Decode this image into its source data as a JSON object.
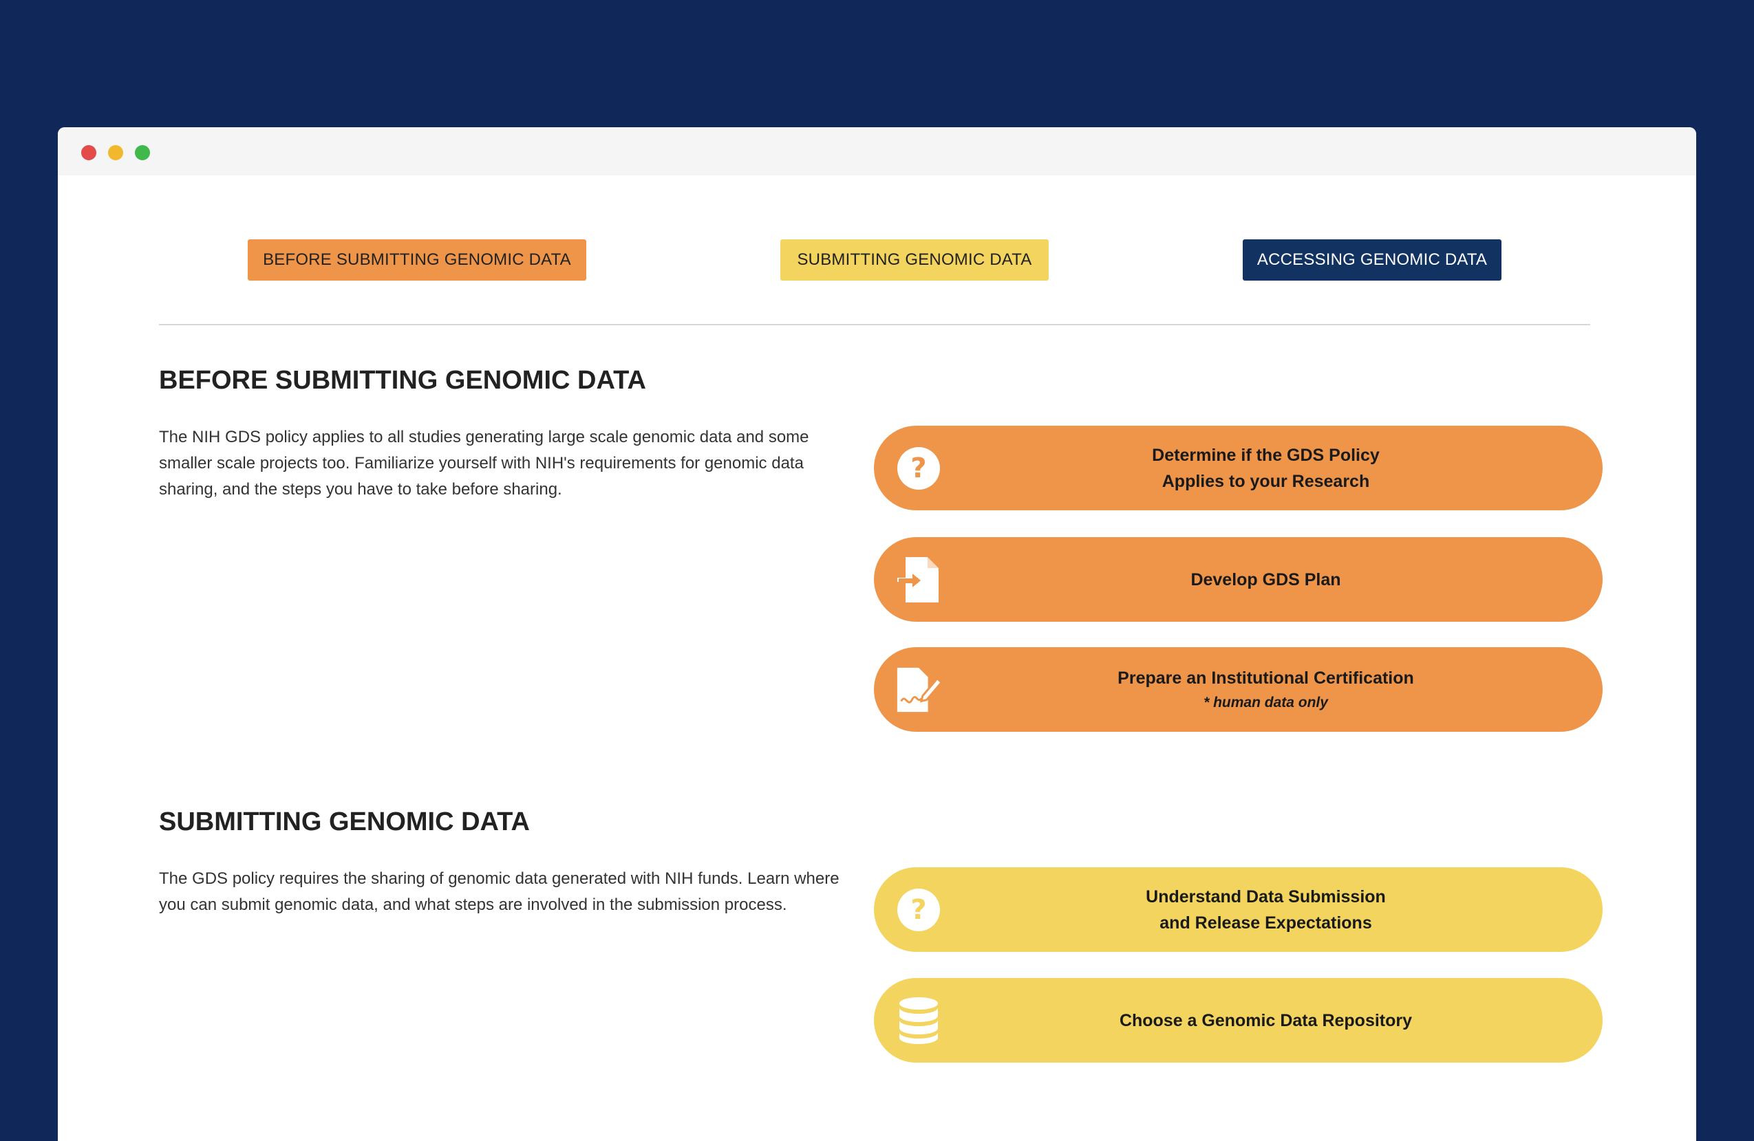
{
  "tabs": [
    {
      "label": "BEFORE SUBMITTING GENOMIC DATA",
      "color": "#ee954a"
    },
    {
      "label": "SUBMITTING GENOMIC DATA",
      "color": "#f2d45f"
    },
    {
      "label": "ACCESSING GENOMIC DATA",
      "color": "#123361"
    }
  ],
  "sections": [
    {
      "heading": "BEFORE SUBMITTING GENOMIC DATA",
      "description": "The NIH GDS policy applies to all studies generating large scale genomic data and some smaller scale projects too. Familiarize yourself with NIH's requirements for genomic data sharing, and the steps you have to take before sharing.",
      "buttons": [
        {
          "line1": "Determine if the GDS Policy",
          "line2": "Applies to your Research",
          "icon": "question-circle-icon"
        },
        {
          "line1": "Develop GDS Plan",
          "icon": "document-import-icon"
        },
        {
          "line1": "Prepare an Institutional Certification",
          "note": "* human data only",
          "icon": "document-signature-icon"
        }
      ]
    },
    {
      "heading": "SUBMITTING GENOMIC DATA",
      "description": "The GDS policy requires the sharing of genomic data generated with NIH funds. Learn where you can submit genomic data, and what steps are involved in the submission process.",
      "buttons": [
        {
          "line1": "Understand Data Submission",
          "line2": "and Release Expectations",
          "icon": "question-circle-icon"
        },
        {
          "line1": "Choose a Genomic Data Repository",
          "icon": "database-icon"
        }
      ]
    }
  ],
  "colors": {
    "background": "#0f2759",
    "orange": "#ee954a",
    "yellow": "#f2d45f",
    "navy": "#123361"
  }
}
